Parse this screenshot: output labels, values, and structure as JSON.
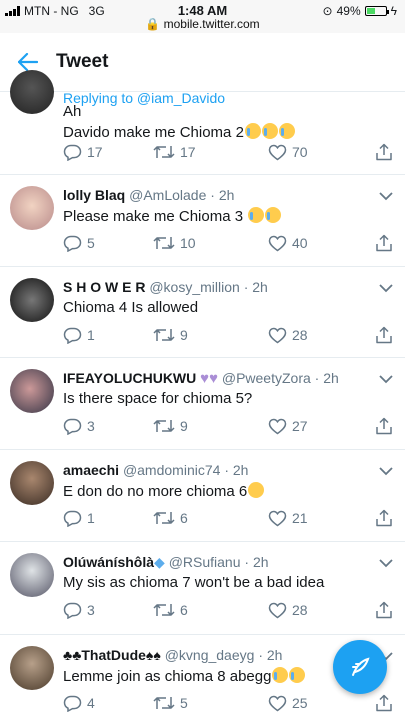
{
  "status": {
    "carrier": "MTN - NG",
    "network": "3G",
    "time": "1:48 AM",
    "url": "mobile.twitter.com",
    "battery": "49%",
    "battery_level": 0.49
  },
  "header": {
    "title": "Tweet"
  },
  "tweets": [
    {
      "replying_to": "Replying to @iam_Davido",
      "line1": "Ah",
      "text": "Davido make me Chioma 2",
      "emoji_count": 3,
      "emoji_kind": "cry",
      "reply": "17",
      "retweet": "17",
      "like": "70"
    },
    {
      "name": "lolly Blaq",
      "handle": "@AmLolade",
      "time": "· 2h",
      "text": "Please make me Chioma 3",
      "emoji_count": 2,
      "emoji_kind": "sad",
      "reply": "5",
      "retweet": "10",
      "like": "40"
    },
    {
      "name": "S H O W E R",
      "handle": "@kosy_million",
      "time": "· 2h",
      "text": "Chioma 4 Is allowed",
      "emoji_count": 0,
      "reply": "1",
      "retweet": "9",
      "like": "28"
    },
    {
      "name": "IFEAYOLUCHUKWU",
      "handle": "@PweetyZora",
      "time": "· 2h",
      "text": "Is there space for chioma 5?",
      "emoji_count": 0,
      "name_emoji": "purple-hearts",
      "reply": "3",
      "retweet": "9",
      "like": "27"
    },
    {
      "name": "amaechi",
      "handle": "@amdominic74",
      "time": "· 2h",
      "text": "E don do no more chioma 6",
      "emoji_count": 1,
      "emoji_kind": "confused",
      "reply": "1",
      "retweet": "6",
      "like": "21"
    },
    {
      "name": "Olúwáníshôlà",
      "handle": "@RSufianu",
      "time": "· 2h",
      "text": "My sis as chioma 7 won't be a bad idea",
      "emoji_count": 0,
      "name_emoji": "gem",
      "reply": "3",
      "retweet": "6",
      "like": "28"
    },
    {
      "name": "♣♣ThatDude♠♠",
      "handle": "@kvng_daeyg",
      "time": "· 2h",
      "text": "Lemme join as chioma 8 abegg",
      "emoji_count": 2,
      "emoji_kind": "laugh",
      "reply": "4",
      "retweet": "5",
      "like": "25"
    }
  ],
  "colors": {
    "accent": "#1da1f2",
    "secondary_text": "#657786",
    "border": "#e6ecf0"
  },
  "icons": {
    "back": "arrow-left-icon",
    "compose": "compose-tweet-icon"
  }
}
